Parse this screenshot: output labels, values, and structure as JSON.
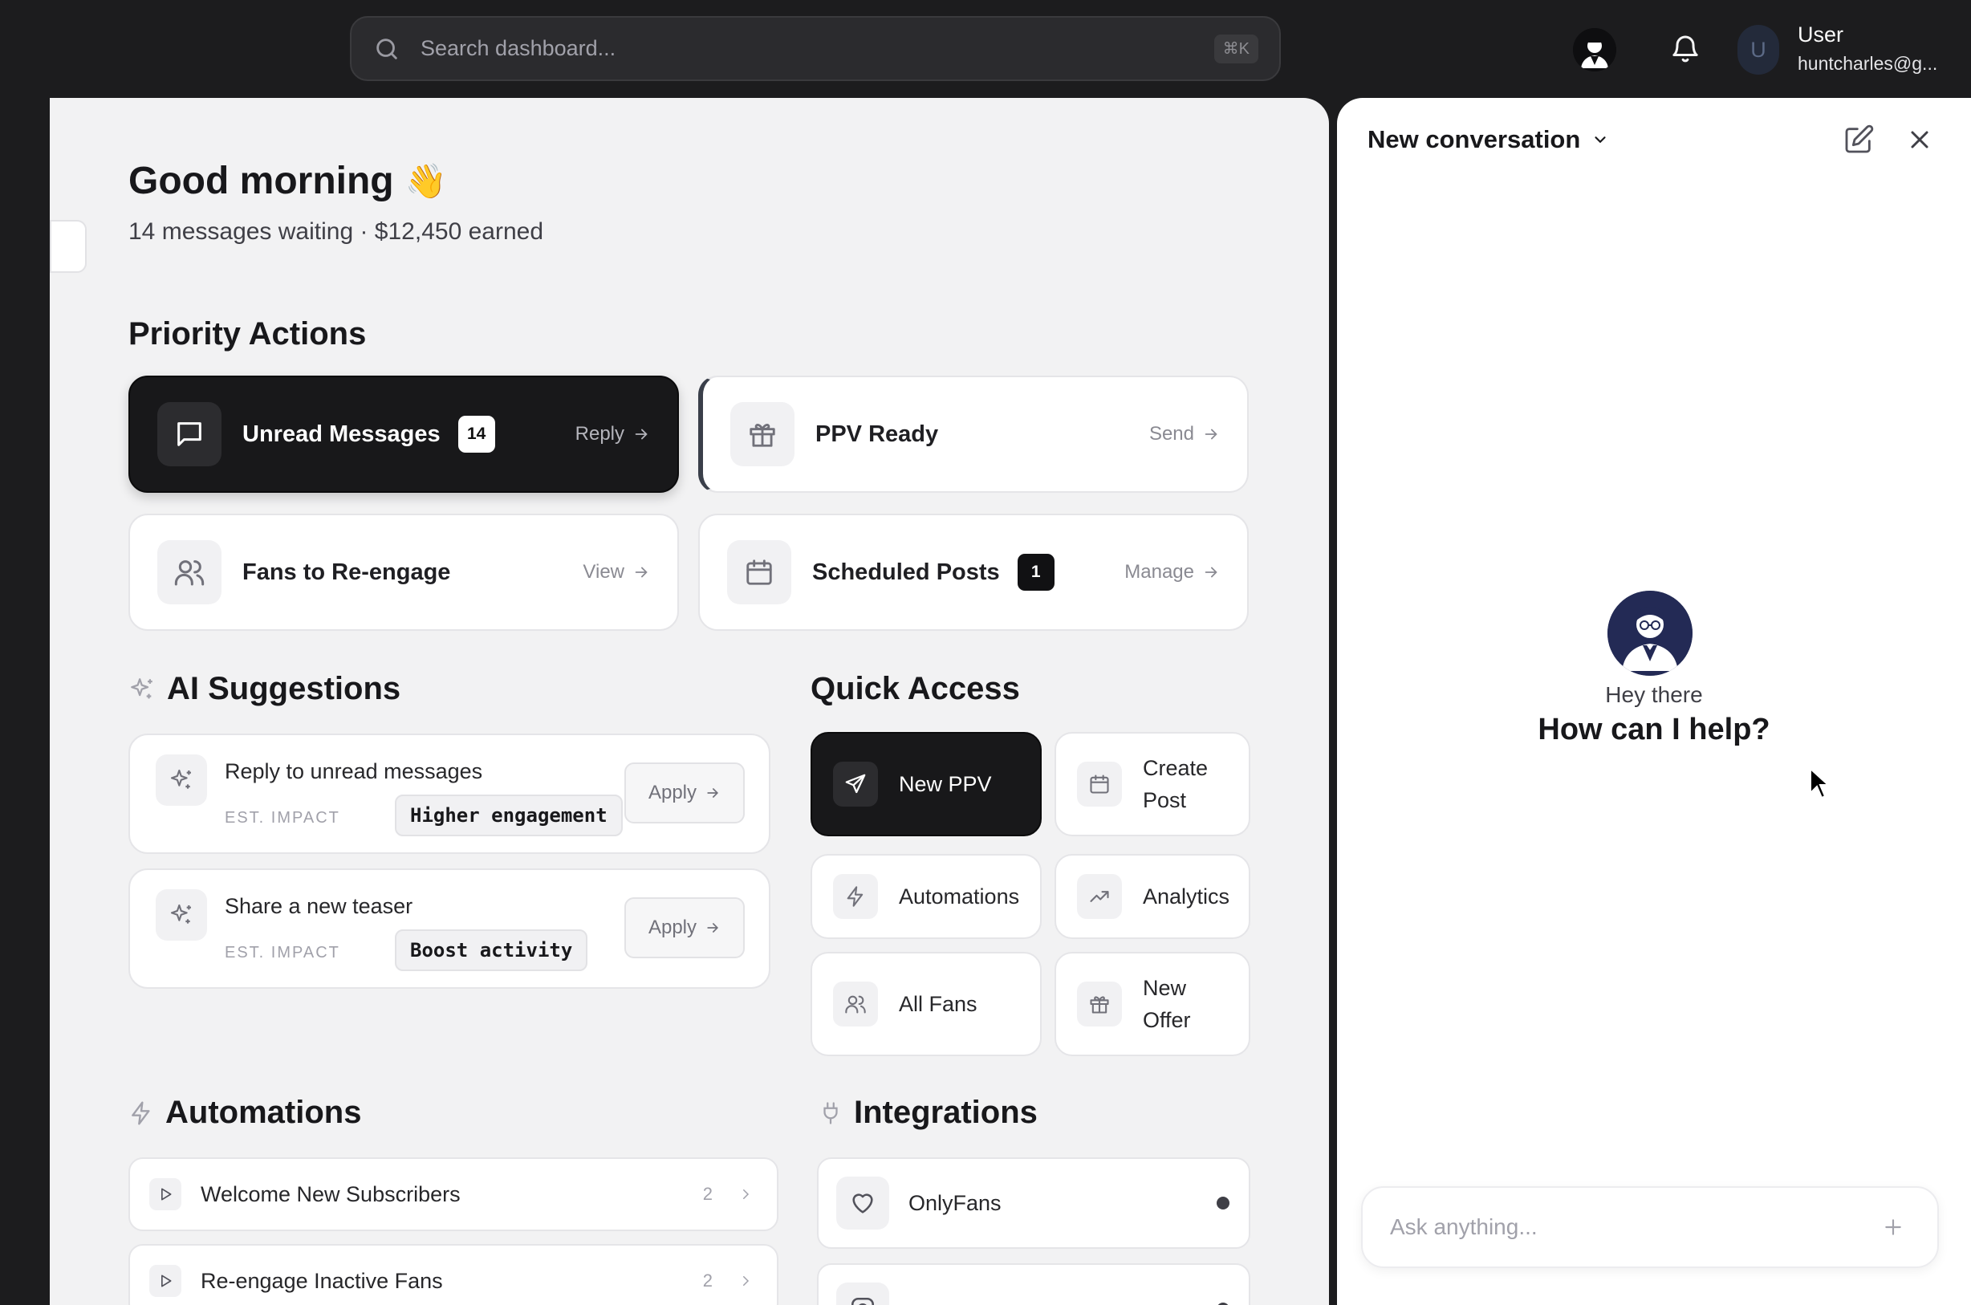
{
  "topbar": {
    "search_placeholder": "Search dashboard...",
    "search_shortcut": "⌘K",
    "user_initial": "U",
    "user_name": "User",
    "user_email": "huntcharles@g..."
  },
  "greeting": {
    "title": "Good morning",
    "emoji": "👋",
    "subtitle": "14 messages waiting · $12,450 earned"
  },
  "priority": {
    "title": "Priority Actions",
    "cards": [
      {
        "label": "Unread Messages",
        "badge": "14",
        "action": "Reply",
        "icon": "message-square-icon"
      },
      {
        "label": "PPV Ready",
        "badge": "",
        "action": "Send",
        "icon": "gift-icon"
      },
      {
        "label": "Fans to Re-engage",
        "badge": "",
        "action": "View",
        "icon": "users-icon"
      },
      {
        "label": "Scheduled Posts",
        "badge": "1",
        "action": "Manage",
        "icon": "calendar-icon"
      }
    ]
  },
  "ai": {
    "title": "AI Suggestions",
    "impact_label": "EST. IMPACT",
    "apply_label": "Apply",
    "suggestions": [
      {
        "title": "Reply to unread messages",
        "impact": "Higher engagement"
      },
      {
        "title": "Share a new teaser",
        "impact": "Boost activity"
      }
    ]
  },
  "quick": {
    "title": "Quick Access",
    "items": [
      {
        "label": "New PPV",
        "icon": "send-icon"
      },
      {
        "label": "Create Post",
        "icon": "calendar-icon"
      },
      {
        "label": "Automations",
        "icon": "zap-icon"
      },
      {
        "label": "Analytics",
        "icon": "trending-up-icon"
      },
      {
        "label": "All Fans",
        "icon": "users-icon"
      },
      {
        "label": "New Offer",
        "icon": "gift-icon"
      }
    ]
  },
  "automations": {
    "title": "Automations",
    "items": [
      {
        "label": "Welcome New Subscribers",
        "count": "2"
      },
      {
        "label": "Re-engage Inactive Fans",
        "count": "2"
      }
    ]
  },
  "integrations": {
    "title": "Integrations",
    "items": [
      {
        "label": "OnlyFans",
        "icon": "heart-icon"
      }
    ]
  },
  "chat": {
    "title": "New conversation",
    "greeting": "Hey there",
    "prompt": "How can I help?",
    "input_placeholder": "Ask anything..."
  },
  "colors": {
    "topbar": "#1c1c1e",
    "main_bg": "#f2f2f3",
    "dark_card": "#18181a",
    "bot_avatar": "#232a55"
  }
}
